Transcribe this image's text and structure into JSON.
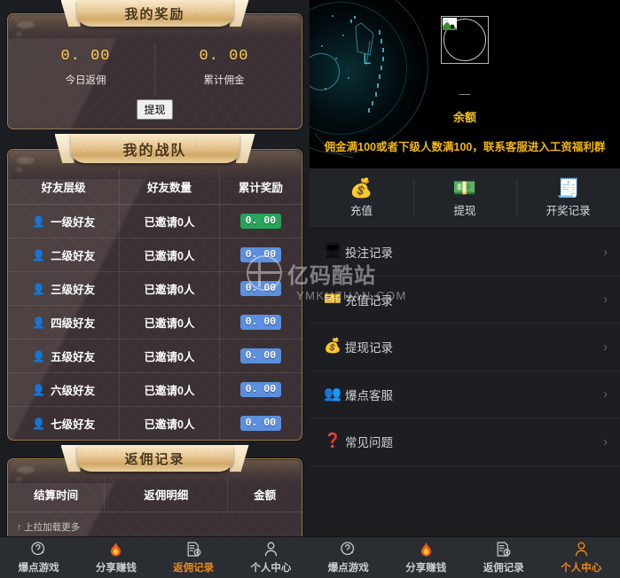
{
  "left": {
    "reward_card": {
      "title": "我的奖励",
      "today": {
        "value": "0. 00",
        "label": "今日返佣"
      },
      "total": {
        "value": "0. 00",
        "label": "累计佣金"
      },
      "withdraw_label": "提现"
    },
    "team_card": {
      "title": "我的战队",
      "columns": [
        "好友层级",
        "好友数量",
        "累计奖励"
      ],
      "rows": [
        {
          "icon": "person-blue-icon",
          "level": "一级好友",
          "count": "已邀请0人",
          "amount": "0. 00",
          "badge": "green"
        },
        {
          "icon": "person-blue-icon",
          "level": "二级好友",
          "count": "已邀请0人",
          "amount": "0. 00",
          "badge": "blue"
        },
        {
          "icon": "person-blue-icon",
          "level": "三级好友",
          "count": "已邀请0人",
          "amount": "0. 00",
          "badge": "blue"
        },
        {
          "icon": "person-blue-icon",
          "level": "四级好友",
          "count": "已邀请0人",
          "amount": "0. 00",
          "badge": "blue"
        },
        {
          "icon": "person-blue-icon",
          "level": "五级好友",
          "count": "已邀请0人",
          "amount": "0. 00",
          "badge": "blue"
        },
        {
          "icon": "person-blue-icon",
          "level": "六级好友",
          "count": "已邀请0人",
          "amount": "0. 00",
          "badge": "blue"
        },
        {
          "icon": "person-blue-icon",
          "level": "七级好友",
          "count": "已邀请0人",
          "amount": "0. 00",
          "badge": "blue"
        }
      ]
    },
    "record_card": {
      "title": "返佣记录",
      "columns": [
        "结算时间",
        "返佣明细",
        "金额"
      ],
      "load_more": "↑ 上拉加载更多"
    },
    "tabbar": [
      {
        "icon": "question-circle-icon",
        "label": "爆点游戏",
        "active": false
      },
      {
        "icon": "flame-icon",
        "label": "分享赚钱",
        "active": false
      },
      {
        "icon": "document-gear-icon",
        "label": "返佣记录",
        "active": true
      },
      {
        "icon": "user-icon",
        "label": "个人中心",
        "active": false
      }
    ]
  },
  "right": {
    "hero": {
      "avatar_icon": "broken-image-icon",
      "username": "—",
      "balance_label": "余额",
      "notice": "佣金满100或者下级人数满100，联系客服进入工资福利群"
    },
    "actions": [
      {
        "icon": "money-bag-icon",
        "glyph": "💰",
        "label": "充值"
      },
      {
        "icon": "cash-icon",
        "glyph": "💵",
        "label": "提现"
      },
      {
        "icon": "lottery-record-icon",
        "glyph": "🧾",
        "label": "开奖记录"
      }
    ],
    "menu": [
      {
        "icon": "monitor-icon",
        "glyph": "🖥",
        "label": "投注记录"
      },
      {
        "icon": "ticket-icon",
        "glyph": "🎫",
        "label": "充值记录"
      },
      {
        "icon": "money-bag-red-icon",
        "glyph": "💰",
        "label": "提现记录"
      },
      {
        "icon": "support-agents-icon",
        "glyph": "👥",
        "label": "爆点客服"
      },
      {
        "icon": "question-mark-icon",
        "glyph": "❓",
        "label": "常见问题"
      }
    ],
    "tabbar": [
      {
        "icon": "question-circle-icon",
        "label": "爆点游戏",
        "active": false
      },
      {
        "icon": "flame-icon",
        "label": "分享赚钱",
        "active": false
      },
      {
        "icon": "document-gear-icon",
        "label": "返佣记录",
        "active": false
      },
      {
        "icon": "user-icon",
        "label": "个人中心",
        "active": true
      }
    ]
  },
  "watermark": {
    "cn": "亿码酷站",
    "en": "YMKUZHAN.COM"
  },
  "colors": {
    "gold": "#f3b70e",
    "accent_orange": "#f08a18",
    "badge_green": "#2aa35d",
    "badge_blue": "#5c8fdd",
    "amount_yellow": "#ffcf54"
  }
}
